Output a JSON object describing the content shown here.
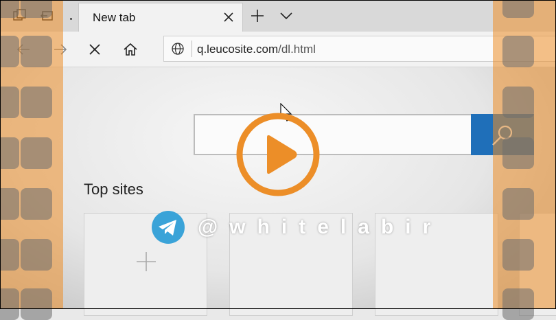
{
  "browser": {
    "tab": {
      "title": "New tab"
    },
    "address": {
      "domain": "q.leucosite.com",
      "path": "/dl.html"
    }
  },
  "page": {
    "search": {
      "placeholder": ""
    },
    "top_sites": {
      "title": "Top sites"
    }
  },
  "overlay": {
    "watermark_handle": "@whitelabir"
  },
  "colors": {
    "film_orange": "#ec8e28",
    "play_orange": "#ec8e28",
    "search_button_blue": "#1f6fb9",
    "telegram_blue": "#3aa3d8"
  },
  "icons": [
    "tab-preview-icon",
    "set-tabs-aside-icon",
    "close-icon",
    "plus-icon",
    "chevron-down-icon",
    "back-arrow-icon",
    "forward-arrow-icon",
    "stop-icon",
    "home-icon",
    "globe-icon",
    "search-icon",
    "mouse-cursor-icon",
    "add-icon",
    "play-icon",
    "telegram-icon"
  ]
}
